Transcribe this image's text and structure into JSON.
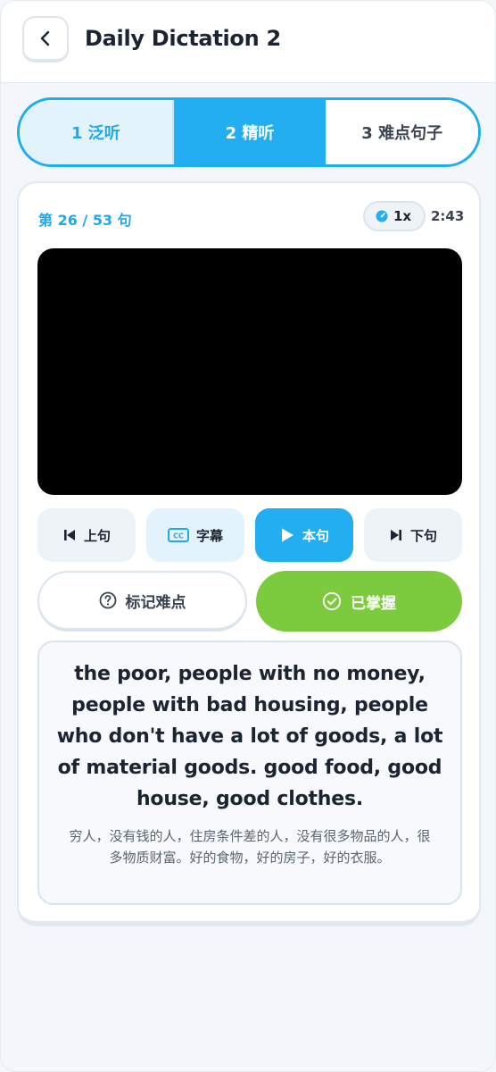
{
  "header": {
    "title": "Daily Dictation 2"
  },
  "tabs": [
    {
      "label": "1 泛听"
    },
    {
      "label": "2 精听"
    },
    {
      "label": "3 难点句子"
    }
  ],
  "card": {
    "progress": "第 26 / 53 句",
    "speed": "1x",
    "timer": "2:43"
  },
  "controls": {
    "prev": "上句",
    "subtitle": "字幕",
    "play": "本句",
    "next": "下句"
  },
  "marks": {
    "hard": "标记难点",
    "done": "已掌握"
  },
  "sentence": {
    "english": "the poor, people with no money, people with bad housing, people who don't have a lot of goods, a lot of material goods. good food, good house, good clothes.",
    "chinese": "穷人，没有钱的人，住房条件差的人，没有很多物品的人，很多物质财富。好的食物，好的房子，好的衣服。"
  },
  "colors": {
    "accent": "#22aef0",
    "success": "#7cca3e"
  }
}
